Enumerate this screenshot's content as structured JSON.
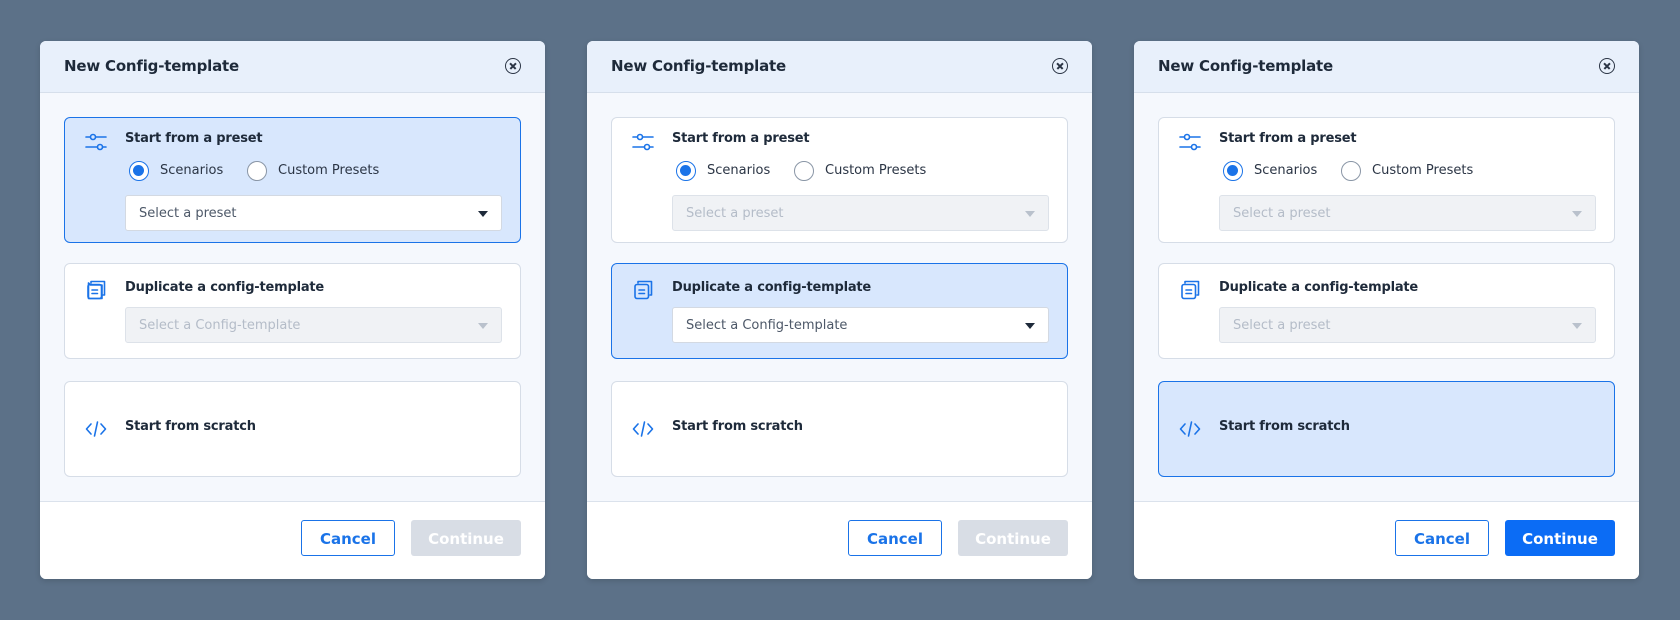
{
  "colors": {
    "background": "#5c7188",
    "accent": "#1a73e8",
    "selected_card": "#d8e7fd",
    "disabled_button": "#d8dde5",
    "primary_button": "#0b6cf5"
  },
  "icons": {
    "close": "close-circle-icon",
    "preset": "sliders-icon",
    "duplicate": "copy-icon",
    "scratch": "code-icon"
  },
  "dialogs": [
    {
      "title": "New Config-template",
      "selected": "preset",
      "preset_card": {
        "label": "Start from a preset",
        "radio_options": [
          "Scenarios",
          "Custom Presets"
        ],
        "selected_radio": "Scenarios",
        "select_placeholder": "Select a preset",
        "select_disabled": false
      },
      "duplicate_card": {
        "label": "Duplicate a config-template",
        "select_placeholder": "Select a Config-template",
        "select_disabled": true
      },
      "scratch_card": {
        "label": "Start from scratch"
      },
      "cancel_label": "Cancel",
      "continue_label": "Continue",
      "continue_enabled": false
    },
    {
      "title": "New Config-template",
      "selected": "duplicate",
      "preset_card": {
        "label": "Start from a preset",
        "radio_options": [
          "Scenarios",
          "Custom Presets"
        ],
        "selected_radio": "Scenarios",
        "select_placeholder": "Select a preset",
        "select_disabled": true
      },
      "duplicate_card": {
        "label": "Duplicate a config-template",
        "select_placeholder": "Select a Config-template",
        "select_disabled": false
      },
      "scratch_card": {
        "label": "Start from scratch"
      },
      "cancel_label": "Cancel",
      "continue_label": "Continue",
      "continue_enabled": false
    },
    {
      "title": "New Config-template",
      "selected": "scratch",
      "preset_card": {
        "label": "Start from a preset",
        "radio_options": [
          "Scenarios",
          "Custom Presets"
        ],
        "selected_radio": "Scenarios",
        "select_placeholder": "Select a preset",
        "select_disabled": true
      },
      "duplicate_card": {
        "label": "Duplicate a config-template",
        "select_placeholder": "Select a preset",
        "select_disabled": true
      },
      "scratch_card": {
        "label": "Start from scratch"
      },
      "cancel_label": "Cancel",
      "continue_label": "Continue",
      "continue_enabled": true
    }
  ]
}
